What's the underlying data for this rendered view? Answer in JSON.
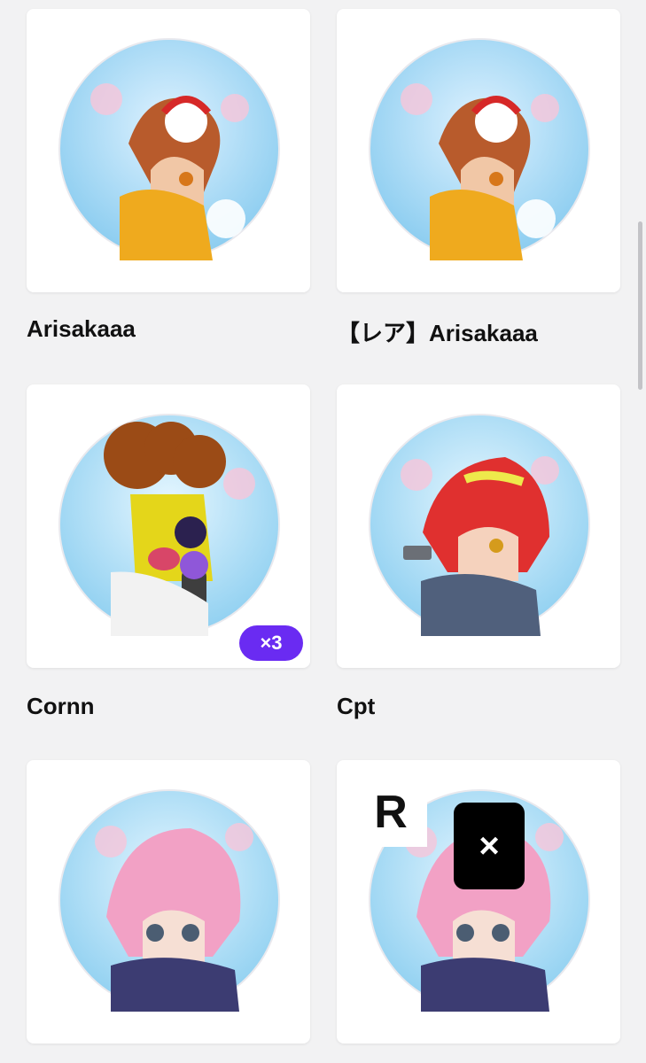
{
  "items": [
    {
      "name": "Arisakaaa"
    },
    {
      "name": "【レア】Arisakaaa"
    },
    {
      "name": "Cornn",
      "count": "×3"
    },
    {
      "name": "Cpt"
    },
    {
      "name": ""
    },
    {
      "name": "",
      "rarity": "R",
      "remove_label": "×"
    }
  ],
  "colors": {
    "background": "#f2f2f3",
    "accent": "#6a2bf2",
    "sky": "#9fd4f3",
    "sakura": "#f7c6da"
  },
  "icons": {
    "close": "close-icon"
  }
}
